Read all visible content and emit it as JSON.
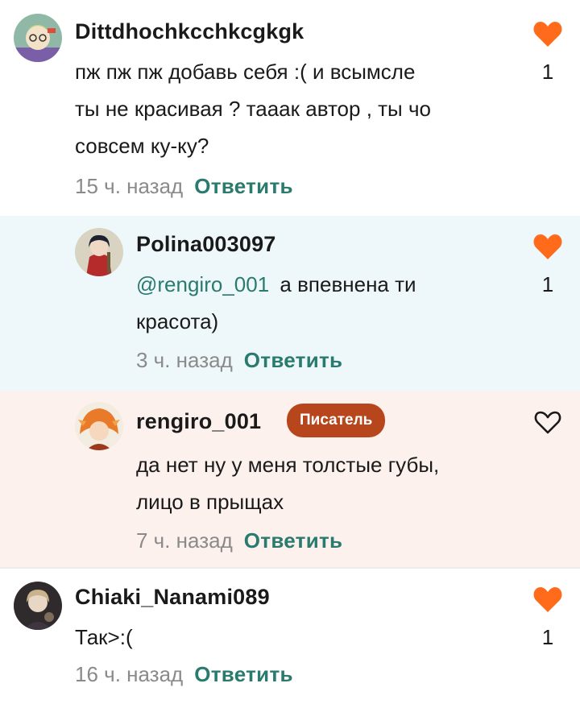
{
  "comments": [
    {
      "username": "Dittdhochkcchkcgkgk",
      "lines": [
        "пж пж пж добавь себя :( и всымсле",
        "ты не красивая ? тааак автор , ты чо",
        "совсем ку-ку?"
      ],
      "time": "15 ч. назад",
      "reply": "Ответить",
      "likes": "1",
      "liked": true,
      "avatar_icon": "avatar-green-hair"
    },
    {
      "username": "Polina003097",
      "mention": "@rengiro_001",
      "lines": [
        "а впевнена ти",
        "красота)"
      ],
      "time": "3 ч. назад",
      "reply": "Ответить",
      "likes": "1",
      "liked": true,
      "avatar_icon": "avatar-red-cloak"
    },
    {
      "username": "rengiro_001",
      "badge": "Писатель",
      "lines": [
        "да нет ну у меня толстые губы,",
        "лицо в прыщах"
      ],
      "time": "7 ч. назад",
      "reply": "Ответить",
      "liked": false,
      "avatar_icon": "avatar-flame-hair"
    },
    {
      "username": "Chiaki_Nanami089",
      "lines": [
        "Так>:("
      ],
      "time": "16 ч. назад",
      "reply": "Ответить",
      "likes": "1",
      "liked": true,
      "avatar_icon": "avatar-dark-portrait"
    }
  ],
  "colors": {
    "heart": "#ff6b1a",
    "reply": "#2a7a6e",
    "badge": "#b8461d",
    "reply_bg_blue": "#eef8fb",
    "reply_bg_pink": "#fcf1ed"
  }
}
